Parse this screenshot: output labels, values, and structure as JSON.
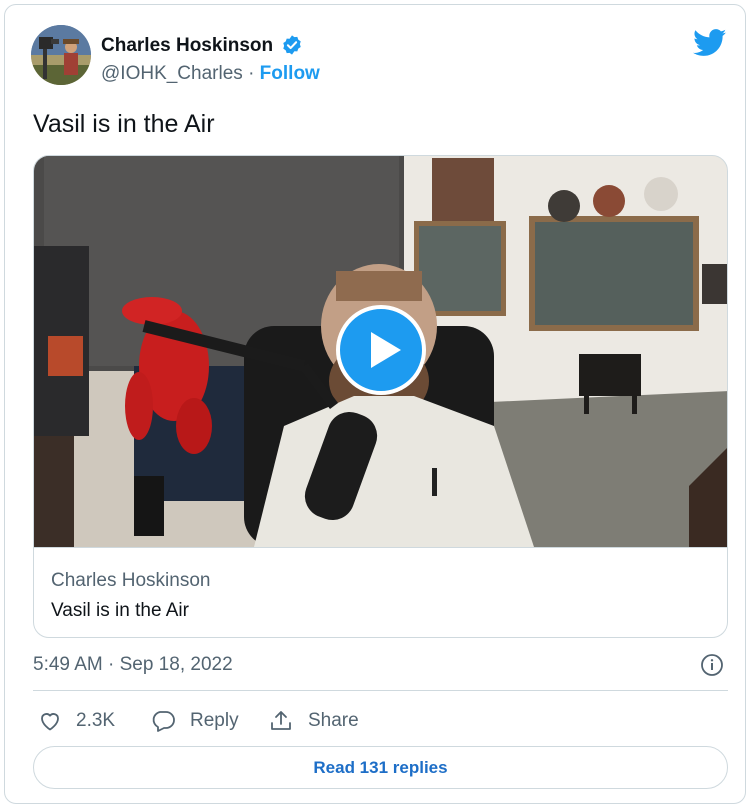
{
  "author": {
    "name": "Charles Hoskinson",
    "handle": "@IOHK_Charles",
    "separator": "·",
    "follow_label": "Follow"
  },
  "tweet": {
    "text": "Vasil is in the Air"
  },
  "media": {
    "card_source": "Charles Hoskinson",
    "card_title": "Vasil is in the Air"
  },
  "meta": {
    "timestamp": "5:49 AM · Sep 18, 2022"
  },
  "actions": {
    "like_count": "2.3K",
    "reply_label": "Reply",
    "share_label": "Share",
    "read_replies_label": "Read 131 replies"
  },
  "icons": {
    "verified": "verified-badge-icon",
    "logo": "twitter-bird-icon",
    "play": "play-icon",
    "info": "info-icon",
    "like": "heart-icon",
    "reply": "speech-bubble-icon",
    "share": "share-upload-icon"
  },
  "colors": {
    "accent": "#1d9bf0",
    "link": "#1d6ec7",
    "secondary_text": "#536471",
    "border": "#cfd9de"
  }
}
